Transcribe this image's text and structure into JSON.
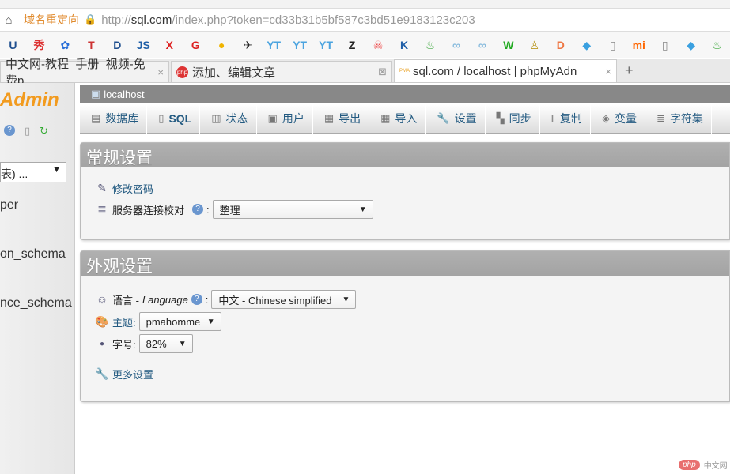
{
  "browser": {
    "address": {
      "redirect_label": "域名重定向",
      "url_scheme": "http://",
      "url_host": "sql.com",
      "url_path": "/index.php?token=cd33b31b5bf587c3bd51e9183123c203"
    },
    "bookmarks": [
      {
        "icon": "ud-icon",
        "glyph": "U",
        "color": "#1f4f8f"
      },
      {
        "icon": "xiu-icon",
        "glyph": "秀",
        "color": "#d33"
      },
      {
        "icon": "baidu-paw-icon",
        "glyph": "✿",
        "color": "#2a6fd8"
      },
      {
        "icon": "t-icon",
        "glyph": "T",
        "color": "#c33"
      },
      {
        "icon": "d-icon",
        "glyph": "D",
        "color": "#1f4f8f"
      },
      {
        "icon": "js-icon",
        "glyph": "JS",
        "color": "#1f5fa8"
      },
      {
        "icon": "x-icon",
        "glyph": "X",
        "color": "#d22"
      },
      {
        "icon": "g-icon",
        "glyph": "G",
        "color": "#d22"
      },
      {
        "icon": "bell-icon",
        "glyph": "●",
        "color": "#f0b400"
      },
      {
        "icon": "runner-icon",
        "glyph": "✈",
        "color": "#222"
      },
      {
        "icon": "yt-icon",
        "glyph": "YT",
        "color": "#4aa3df"
      },
      {
        "icon": "yt-icon",
        "glyph": "YT",
        "color": "#4aa3df"
      },
      {
        "icon": "yt-icon",
        "glyph": "YT",
        "color": "#4aa3df"
      },
      {
        "icon": "z-icon",
        "glyph": "Z",
        "color": "#222"
      },
      {
        "icon": "skull-icon",
        "glyph": "☠",
        "color": "#e44"
      },
      {
        "icon": "k-icon",
        "glyph": "K",
        "color": "#1f5fa8"
      },
      {
        "icon": "swirl-icon",
        "glyph": "♨",
        "color": "#4a4"
      },
      {
        "icon": "link-icon",
        "glyph": "∞",
        "color": "#8bd"
      },
      {
        "icon": "link-icon",
        "glyph": "∞",
        "color": "#8bd"
      },
      {
        "icon": "w-icon",
        "glyph": "W",
        "color": "#2a2"
      },
      {
        "icon": "figure-icon",
        "glyph": "♙",
        "color": "#b92"
      },
      {
        "icon": "d-outline-icon",
        "glyph": "D",
        "color": "#e74"
      },
      {
        "icon": "diamond-icon",
        "glyph": "◆",
        "color": "#3aa0e0"
      },
      {
        "icon": "page-icon",
        "glyph": "▯",
        "color": "#888"
      },
      {
        "icon": "mi-icon",
        "glyph": "mi",
        "color": "#f60"
      },
      {
        "icon": "page-icon",
        "glyph": "▯",
        "color": "#888"
      },
      {
        "icon": "diamond-icon",
        "glyph": "◆",
        "color": "#3aa0e0"
      },
      {
        "icon": "swirl-icon",
        "glyph": "♨",
        "color": "#4a4"
      }
    ],
    "tabs": [
      {
        "label": "中文网-教程_手册_视频-免费p"
      },
      {
        "label": "添加、编辑文章",
        "fav": "php"
      },
      {
        "label": "sql.com / localhost | phpMyAdn",
        "fav": "PMA"
      }
    ]
  },
  "sidebar": {
    "logo": "Admin",
    "db_select": "表) ...",
    "databases": [
      "per",
      "on_schema",
      "nce_schema"
    ]
  },
  "main": {
    "server": "localhost",
    "menu": [
      {
        "label": "数据库",
        "icon": "database-icon",
        "g": "▤"
      },
      {
        "label": "SQL",
        "icon": "sql-icon",
        "g": "▯"
      },
      {
        "label": "状态",
        "icon": "status-icon",
        "g": "▥"
      },
      {
        "label": "用户",
        "icon": "users-icon",
        "g": "▣"
      },
      {
        "label": "导出",
        "icon": "export-icon",
        "g": "▦"
      },
      {
        "label": "导入",
        "icon": "import-icon",
        "g": "▦"
      },
      {
        "label": "设置",
        "icon": "wrench-icon",
        "g": "🔧"
      },
      {
        "label": "同步",
        "icon": "sync-icon",
        "g": "▚"
      },
      {
        "label": "复制",
        "icon": "replication-icon",
        "g": "‖"
      },
      {
        "label": "变量",
        "icon": "variables-icon",
        "g": "◈"
      },
      {
        "label": "字符集",
        "icon": "charset-icon",
        "g": "≣"
      }
    ],
    "general": {
      "title": "常规设置",
      "change_password": "修改密码",
      "collation_label": "服务器连接校对",
      "collation_value": "整理"
    },
    "appearance": {
      "title": "外观设置",
      "language_label": "语言 - ",
      "language_italic": "Language",
      "language_value": "中文 - Chinese simplified",
      "theme_label": "主题:",
      "theme_value": "pmahomme",
      "font_label": "字号:",
      "font_value": "82%",
      "more_settings": "更多设置"
    }
  },
  "watermark": {
    "logo": "php",
    "text": "中文网"
  }
}
